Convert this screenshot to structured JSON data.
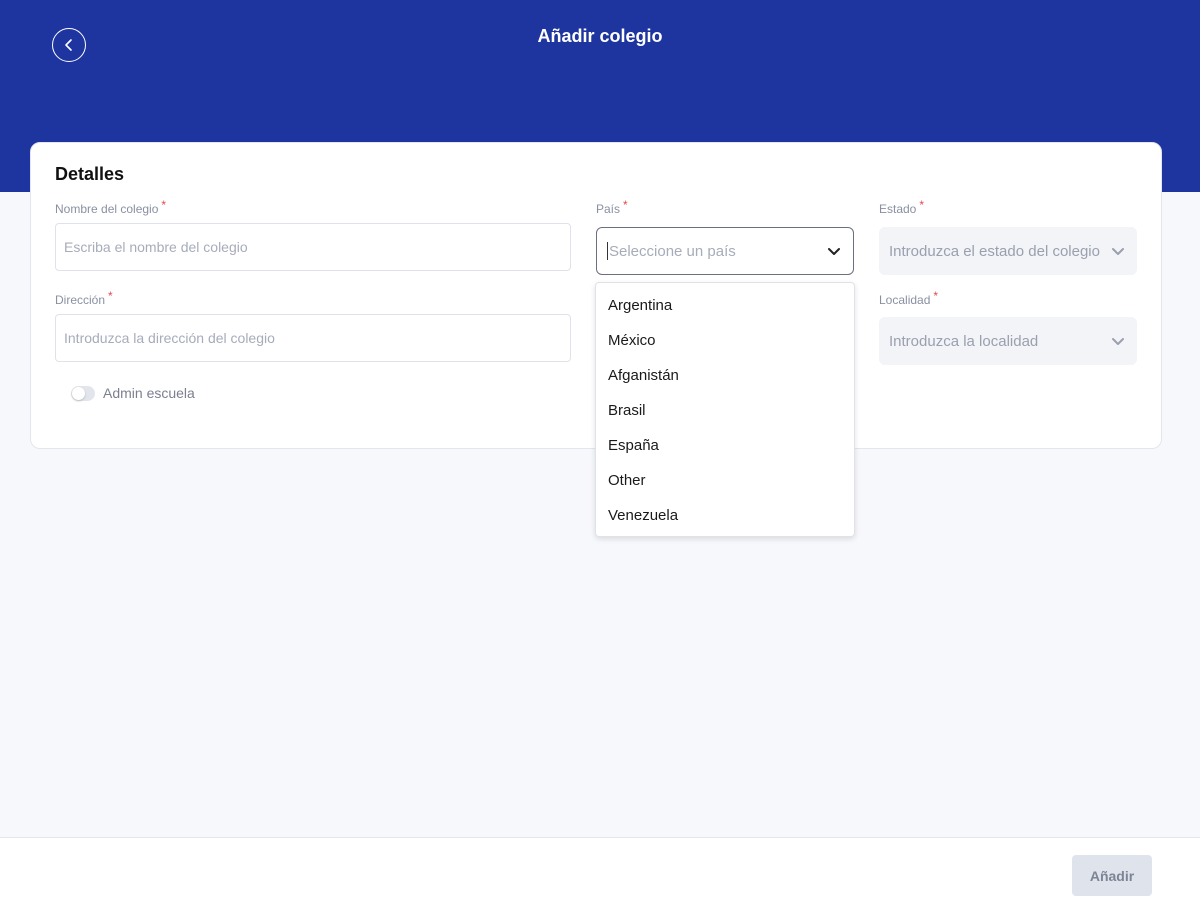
{
  "header": {
    "title": "Añadir colegio",
    "back_icon": "chevron-left-icon"
  },
  "details": {
    "section_title": "Detalles",
    "school_name": {
      "label": "Nombre del colegio",
      "required_mark": "*",
      "placeholder": "Escriba el nombre del colegio",
      "value": ""
    },
    "address": {
      "label": "Dirección",
      "required_mark": "*",
      "placeholder": "Introduzca la dirección del colegio",
      "value": ""
    },
    "country": {
      "label": "País",
      "required_mark": "*",
      "placeholder": "Seleccione un país",
      "options": [
        "Argentina",
        "México",
        "Afganistán",
        "Brasil",
        "España",
        "Other",
        "Venezuela"
      ]
    },
    "state": {
      "label": "Estado",
      "required_mark": "*",
      "placeholder": "Introduzca el estado del colegio"
    },
    "locality": {
      "label": "Localidad",
      "required_mark": "*",
      "placeholder": "Introduzca la localidad"
    },
    "admin_toggle": {
      "label": "Admin escuela",
      "checked": false
    }
  },
  "footer": {
    "add_label": "Añadir"
  },
  "colors": {
    "header_bg": "#1e35a0",
    "required": "#e5484d",
    "disabled_button": "#dfe3ec"
  }
}
